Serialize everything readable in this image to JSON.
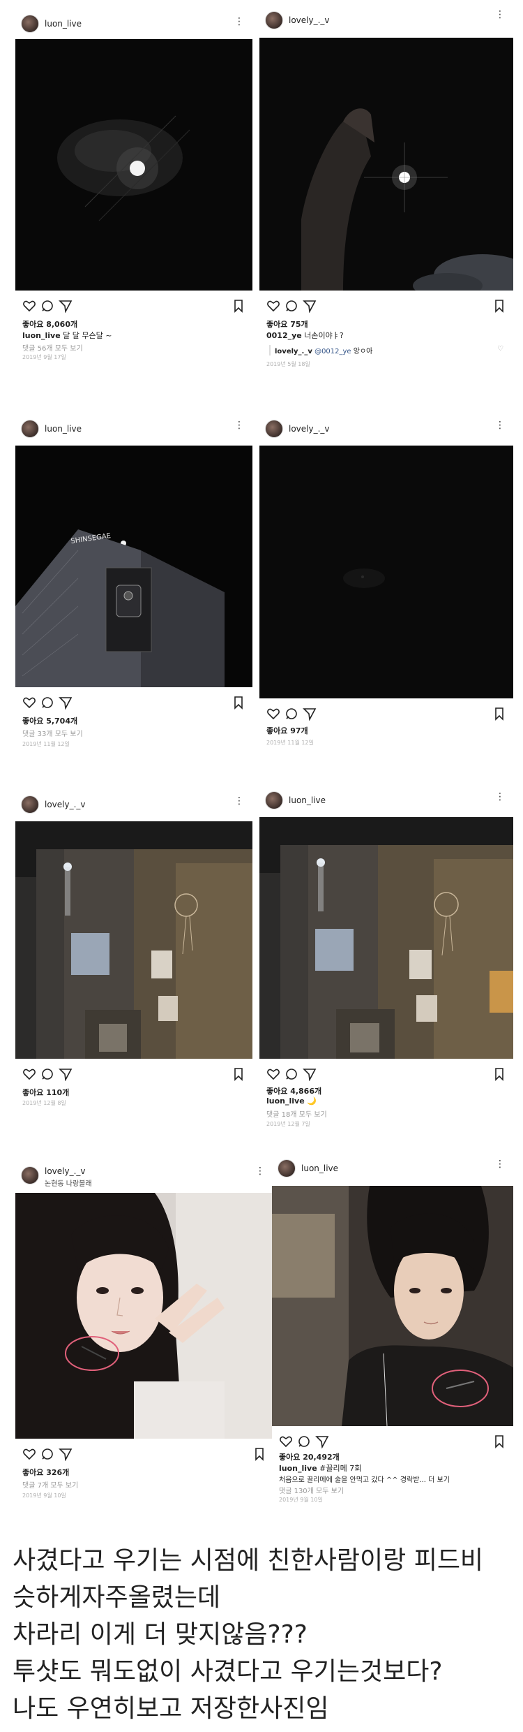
{
  "posts": [
    {
      "username": "luon_live",
      "likes": "좋아요 8,060개",
      "caption_user": "luon_live",
      "caption_text": " 달 달 무슨달 ~",
      "comments": "댓글 56개 모두 보기",
      "date": "2019년 9월 17일"
    },
    {
      "username": "lovely_._v",
      "likes": "좋아요 75개",
      "caption_user": "0012_ye",
      "caption_text": " 너손이야ㅑ?",
      "reply_user": "lovely_._v",
      "reply_mention": "@0012_ye",
      "reply_text": " 앙ㅇ아",
      "date": "2019년 5월 18일"
    },
    {
      "username": "luon_live",
      "photo_sign": "SHINSEGAE",
      "likes": "좋아요 5,704개",
      "comments": "댓글 33개 모두 보기",
      "date": "2019년 11월 12일"
    },
    {
      "username": "lovely_._v",
      "likes": "좋아요 97개",
      "date": "2019년 11월 12일"
    },
    {
      "username": "lovely_._v",
      "likes": "좋아요 110개",
      "date": "2019년 12월 8일"
    },
    {
      "username": "luon_live",
      "likes": "좋아요 4,866개",
      "caption_user": "luon_live",
      "caption_text": " 🌙",
      "comments": "댓글 18개 모두 보기",
      "date": "2019년 12월 7일"
    },
    {
      "username": "lovely_._v",
      "sublabel": "논현동 나랑볼래",
      "likes": "좋아요 326개",
      "comments": "댓글 7개 모두 보기",
      "date": "2019년 9월 10일"
    },
    {
      "username": "luon_live",
      "likes": "좋아요 20,492개",
      "caption_user": "luon_live",
      "caption_text": " #끌리메 7회",
      "caption_line2": "처음으로 끌리메에 술을 안먹고 갔다 ^^ 경락받... 더 보기",
      "comments": "댓글 130개 모두 보기",
      "date": "2019년 9월 10일"
    }
  ],
  "bottom_text": [
    "사겼다고 우기는 시점에 친한사람이랑 피드비",
    "슷하게자주올렸는데",
    "차라리 이게 더 맞지않음???",
    "투샷도 뭐도없이 사겼다고 우기는것보다?",
    "나도 우연히보고 저장한사진임"
  ],
  "colors": {
    "highlight_circle": "#e0607a",
    "photo_dark": "#0c0c0c"
  }
}
